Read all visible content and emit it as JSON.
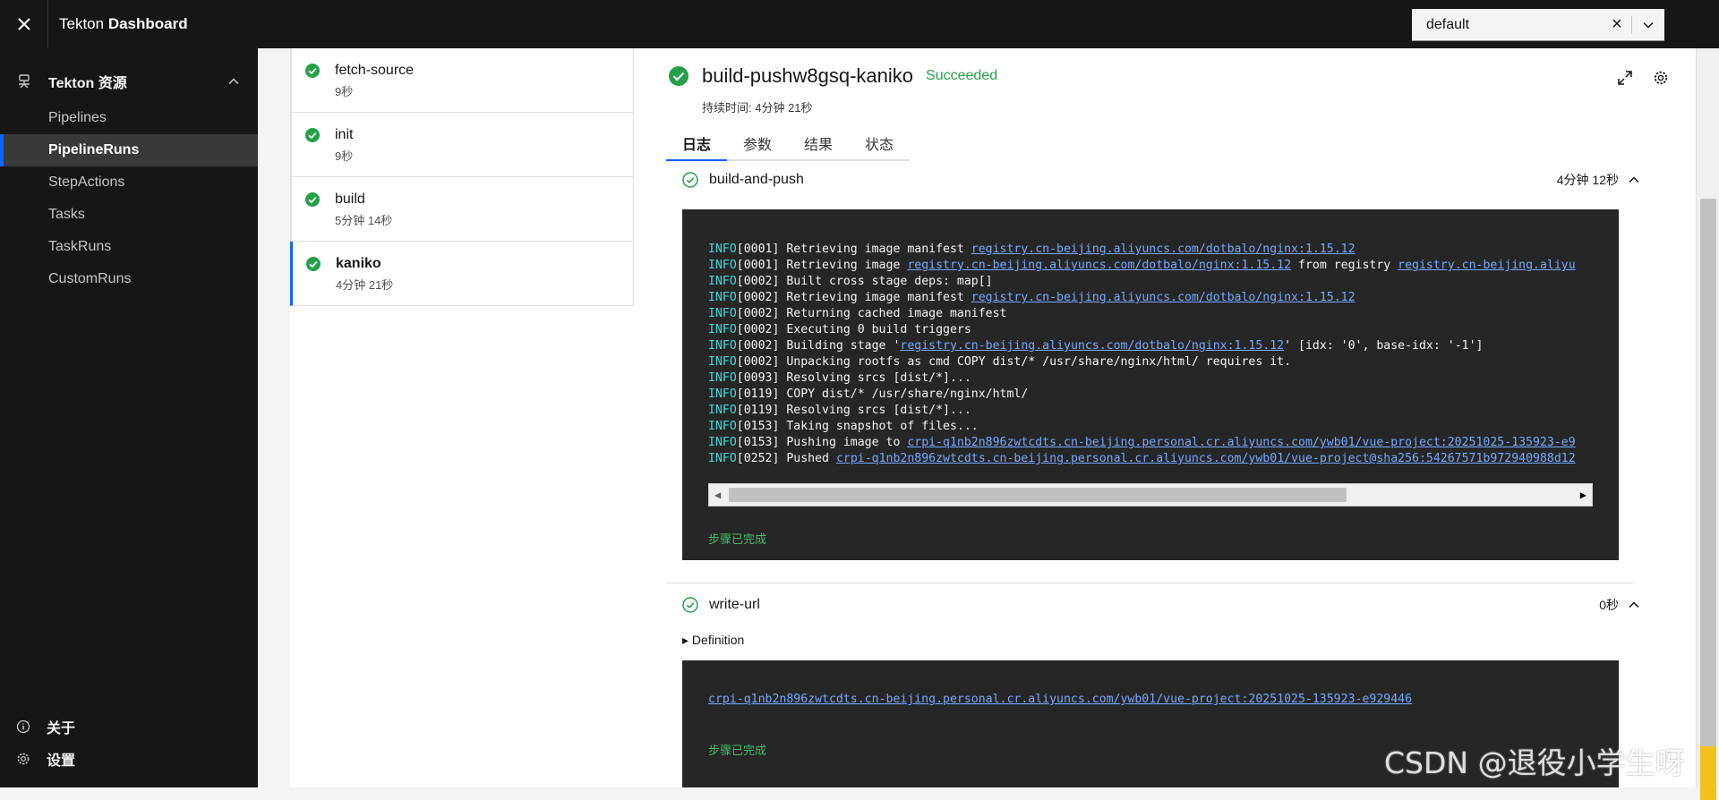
{
  "header": {
    "title_prefix": "Tekton ",
    "title_bold": "Dashboard",
    "namespace": "default"
  },
  "sidebar": {
    "section": "Tekton 资源",
    "items": [
      {
        "label": "Pipelines"
      },
      {
        "label": "PipelineRuns"
      },
      {
        "label": "StepActions"
      },
      {
        "label": "Tasks"
      },
      {
        "label": "TaskRuns"
      },
      {
        "label": "CustomRuns"
      }
    ],
    "about": "关于",
    "settings": "设置"
  },
  "tasks": [
    {
      "name": "fetch-source",
      "duration": "9秒"
    },
    {
      "name": "init",
      "duration": "9秒"
    },
    {
      "name": "build",
      "duration": "5分钟 14秒"
    },
    {
      "name": "kaniko",
      "duration": "4分钟 21秒"
    }
  ],
  "detail": {
    "name": "build-pushw8gsq-kaniko",
    "status": "Succeeded",
    "duration": "持续时间: 4分钟 21秒",
    "tabs": [
      "日志",
      "参数",
      "结果",
      "状态"
    ]
  },
  "steps": [
    {
      "name": "build-and-push",
      "duration": "4分钟 12秒",
      "status": "步骤已完成",
      "log": [
        {
          "prefix": "INFO",
          "seq": "[0001]",
          "parts": [
            {
              "t": " Retrieving image manifest "
            },
            {
              "l": "registry.cn-beijing.aliyuncs.com/dotbalo/nginx:1.15.12"
            }
          ]
        },
        {
          "prefix": "INFO",
          "seq": "[0001]",
          "parts": [
            {
              "t": " Retrieving image "
            },
            {
              "l": "registry.cn-beijing.aliyuncs.com/dotbalo/nginx:1.15.12"
            },
            {
              "t": " from registry "
            },
            {
              "l": "registry.cn-beijing.aliyu"
            }
          ]
        },
        {
          "prefix": "INFO",
          "seq": "[0002]",
          "parts": [
            {
              "t": " Built cross stage deps: map[]"
            }
          ]
        },
        {
          "prefix": "INFO",
          "seq": "[0002]",
          "parts": [
            {
              "t": " Retrieving image manifest "
            },
            {
              "l": "registry.cn-beijing.aliyuncs.com/dotbalo/nginx:1.15.12"
            }
          ]
        },
        {
          "prefix": "INFO",
          "seq": "[0002]",
          "parts": [
            {
              "t": " Returning cached image manifest"
            }
          ]
        },
        {
          "prefix": "INFO",
          "seq": "[0002]",
          "parts": [
            {
              "t": " Executing 0 build triggers"
            }
          ]
        },
        {
          "prefix": "INFO",
          "seq": "[0002]",
          "parts": [
            {
              "t": " Building stage '"
            },
            {
              "l": "registry.cn-beijing.aliyuncs.com/dotbalo/nginx:1.15.12"
            },
            {
              "t": "' [idx: '0', base-idx: '-1']"
            }
          ]
        },
        {
          "prefix": "INFO",
          "seq": "[0002]",
          "parts": [
            {
              "t": " Unpacking rootfs as cmd COPY dist/* /usr/share/nginx/html/ requires it."
            }
          ]
        },
        {
          "prefix": "INFO",
          "seq": "[0093]",
          "parts": [
            {
              "t": " Resolving srcs [dist/*]..."
            }
          ]
        },
        {
          "prefix": "INFO",
          "seq": "[0119]",
          "parts": [
            {
              "t": " COPY dist/* /usr/share/nginx/html/"
            }
          ]
        },
        {
          "prefix": "INFO",
          "seq": "[0119]",
          "parts": [
            {
              "t": " Resolving srcs [dist/*]..."
            }
          ]
        },
        {
          "prefix": "INFO",
          "seq": "[0153]",
          "parts": [
            {
              "t": " Taking snapshot of files..."
            }
          ]
        },
        {
          "prefix": "INFO",
          "seq": "[0153]",
          "parts": [
            {
              "t": " Pushing image to "
            },
            {
              "l": "crpi-q1nb2n896zwtcdts.cn-beijing.personal.cr.aliyuncs.com/ywb01/vue-project:20251025-135923-e9"
            }
          ]
        },
        {
          "prefix": "INFO",
          "seq": "[0252]",
          "parts": [
            {
              "t": " Pushed "
            },
            {
              "l": "crpi-q1nb2n896zwtcdts.cn-beijing.personal.cr.aliyuncs.com/ywb01/vue-project@sha256:54267571b972940988d12"
            }
          ]
        }
      ]
    },
    {
      "name": "write-url",
      "duration": "0秒",
      "definition": "Definition",
      "status": "步骤已完成",
      "output": "crpi-q1nb2n896zwtcdts.cn-beijing.personal.cr.aliyuncs.com/ywb01/vue-project:20251025-135923-e929446"
    }
  ],
  "watermark": "CSDN @退役小学生呀",
  "colors": {
    "success": "#24a148",
    "accent": "#0f62fe",
    "link": "#78a9ff",
    "info": "#3ddbd9"
  }
}
